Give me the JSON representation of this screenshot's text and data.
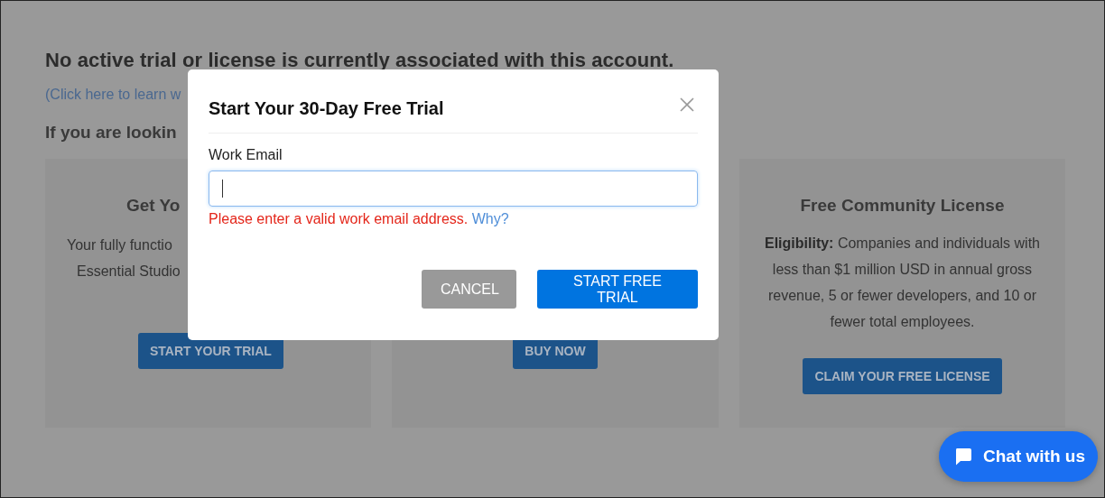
{
  "page": {
    "heading": "No active trial or license is currently associated with this account.",
    "learn_link": "(Click here to learn w",
    "intro": "If you are lookin"
  },
  "cards": [
    {
      "title": "Get Yo",
      "lines": [
        "Your fully functio",
        "Essential Studio"
      ],
      "button": "START YOUR TRIAL"
    },
    {
      "button": "BUY NOW"
    },
    {
      "title": "Free Community License",
      "text": "**Eligibility:** Companies and individuals with less than $1 million USD in annual gross revenue, 5 or fewer developers, and 10 or fewer total employees.",
      "button": "CLAIM YOUR FREE LICENSE"
    }
  ],
  "dialog": {
    "title": "Start Your 30-Day Free Trial",
    "field_label": "Work Email",
    "error": "Please enter a valid work email address.",
    "error_link": "Why?",
    "buttons": [
      {
        "label": "CANCEL",
        "kind": "secondary"
      },
      {
        "label": "START FREE TRIAL",
        "kind": "primary"
      }
    ]
  },
  "chat": {
    "label": "Chat with us"
  }
}
